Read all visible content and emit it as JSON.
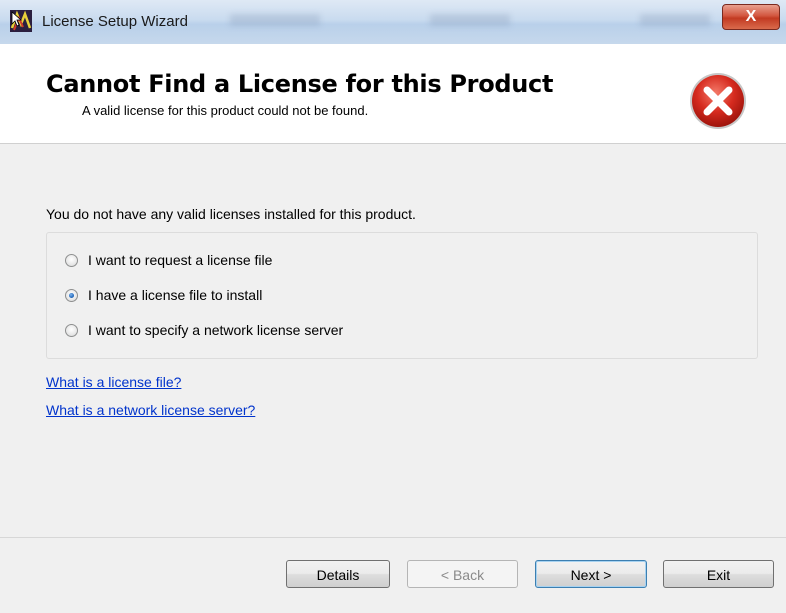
{
  "window": {
    "title": "License Setup Wizard",
    "close_label": "X"
  },
  "header": {
    "title": "Cannot Find a License for this Product",
    "subtitle": "A valid license for this product could not be found."
  },
  "body": {
    "intro": "You do not have any valid licenses installed for this product.",
    "options": [
      {
        "label": "I want to request a license file",
        "checked": false
      },
      {
        "label": "I have a license file to install",
        "checked": true
      },
      {
        "label": "I want to specify a network license server",
        "checked": false
      }
    ],
    "links": [
      "What is a license file?",
      "What is a network license server?"
    ]
  },
  "buttons": {
    "details": "Details",
    "back": "< Back",
    "next": "Next >",
    "exit": "Exit"
  },
  "colors": {
    "link": "#0033cc",
    "error_red": "#d62b1f",
    "panel_bg": "#f0f0f0"
  }
}
